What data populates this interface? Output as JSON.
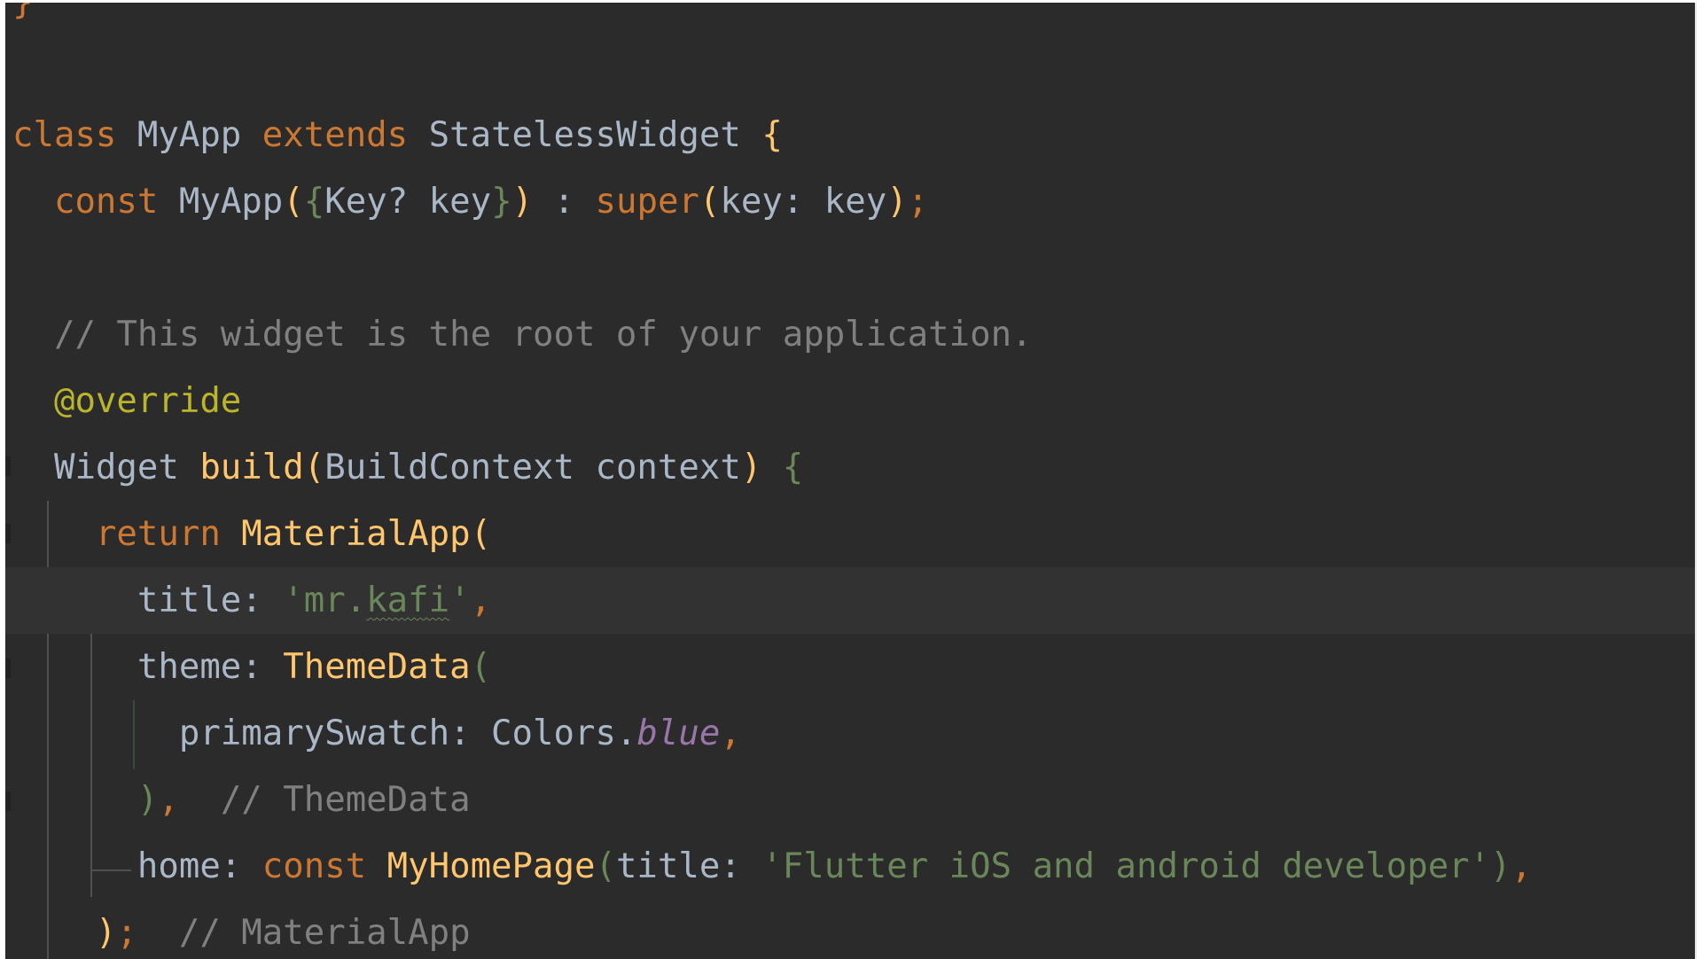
{
  "editor": {
    "lines": [
      {
        "segments": [
          {
            "t": "}",
            "c": "kw"
          }
        ]
      },
      {
        "segments": []
      },
      {
        "segments": [
          {
            "t": "class",
            "c": "kw"
          },
          {
            "t": " MyApp ",
            "c": "txt"
          },
          {
            "t": "extends",
            "c": "kw"
          },
          {
            "t": " StatelessWidget ",
            "c": "txt"
          },
          {
            "t": "{",
            "c": "fn"
          }
        ]
      },
      {
        "segments": [
          {
            "t": "  ",
            "c": "txt"
          },
          {
            "t": "const",
            "c": "kw"
          },
          {
            "t": " MyApp",
            "c": "txt"
          },
          {
            "t": "(",
            "c": "fn"
          },
          {
            "t": "{",
            "c": "brace-g"
          },
          {
            "t": "Key? key",
            "c": "txt"
          },
          {
            "t": "}",
            "c": "brace-g"
          },
          {
            "t": ")",
            "c": "fn"
          },
          {
            "t": " : ",
            "c": "txt"
          },
          {
            "t": "super",
            "c": "kw"
          },
          {
            "t": "(",
            "c": "fn"
          },
          {
            "t": "key: key",
            "c": "txt"
          },
          {
            "t": ")",
            "c": "fn"
          },
          {
            "t": ";",
            "c": "kw"
          }
        ]
      },
      {
        "segments": []
      },
      {
        "segments": [
          {
            "t": "  ",
            "c": "txt"
          },
          {
            "t": "// This widget is the root of your application.",
            "c": "cmt"
          }
        ]
      },
      {
        "segments": [
          {
            "t": "  ",
            "c": "txt"
          },
          {
            "t": "@override",
            "c": "ann"
          }
        ]
      },
      {
        "segments": [
          {
            "t": "  Widget ",
            "c": "txt"
          },
          {
            "t": "build",
            "c": "fn"
          },
          {
            "t": "(",
            "c": "fn"
          },
          {
            "t": "BuildContext context",
            "c": "txt"
          },
          {
            "t": ")",
            "c": "fn"
          },
          {
            "t": " ",
            "c": "txt"
          },
          {
            "t": "{",
            "c": "brace-g"
          }
        ]
      },
      {
        "segments": [
          {
            "t": "    ",
            "c": "txt"
          },
          {
            "t": "return",
            "c": "kw"
          },
          {
            "t": " ",
            "c": "txt"
          },
          {
            "t": "MaterialApp",
            "c": "fn"
          },
          {
            "t": "(",
            "c": "fn"
          }
        ]
      },
      {
        "current": true,
        "segments": [
          {
            "t": "      title: ",
            "c": "txt"
          },
          {
            "t": "'mr.",
            "c": "str"
          },
          {
            "t": "kafi",
            "c": "str squiggle"
          },
          {
            "t": "'",
            "c": "str"
          },
          {
            "t": ",",
            "c": "kw"
          }
        ]
      },
      {
        "segments": [
          {
            "t": "      theme: ",
            "c": "txt"
          },
          {
            "t": "ThemeData",
            "c": "fn"
          },
          {
            "t": "(",
            "c": "brace-g"
          }
        ]
      },
      {
        "segments": [
          {
            "t": "        primarySwatch: Colors.",
            "c": "txt"
          },
          {
            "t": "blue",
            "c": "stat"
          },
          {
            "t": ",",
            "c": "kw"
          }
        ]
      },
      {
        "segments": [
          {
            "t": "      ",
            "c": "txt"
          },
          {
            "t": ")",
            "c": "brace-g"
          },
          {
            "t": ",",
            "c": "kw"
          },
          {
            "t": "  // ThemeData",
            "c": "cmt"
          }
        ]
      },
      {
        "segments": [
          {
            "t": "      home: ",
            "c": "txt"
          },
          {
            "t": "const",
            "c": "kw"
          },
          {
            "t": " ",
            "c": "txt"
          },
          {
            "t": "MyHomePage",
            "c": "fn"
          },
          {
            "t": "(",
            "c": "brace-g"
          },
          {
            "t": "title: ",
            "c": "txt"
          },
          {
            "t": "'Flutter iOS and android developer'",
            "c": "str"
          },
          {
            "t": ")",
            "c": "brace-g"
          },
          {
            "t": ",",
            "c": "kw"
          }
        ]
      },
      {
        "segments": [
          {
            "t": "    ",
            "c": "txt"
          },
          {
            "t": ")",
            "c": "fn"
          },
          {
            "t": ";",
            "c": "kw"
          },
          {
            "t": "  // MaterialApp",
            "c": "cmt"
          }
        ]
      }
    ]
  }
}
